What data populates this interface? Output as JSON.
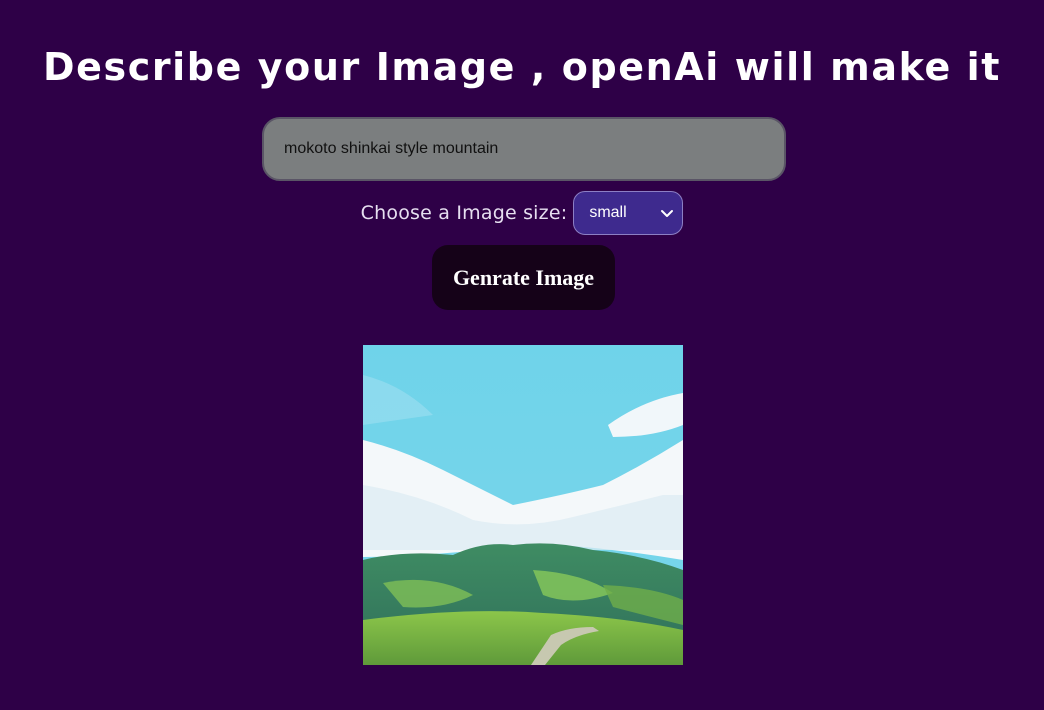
{
  "header": {
    "title": "Describe your Image , openAi will make it"
  },
  "prompt": {
    "value": "mokoto shinkai style mountain",
    "placeholder": ""
  },
  "size_picker": {
    "label": "Choose a Image size:",
    "selected": "small"
  },
  "generate_button": {
    "label": "Genrate Image"
  },
  "colors": {
    "background": "#2e0047",
    "input_bg": "#7b7e7f",
    "select_bg": "#3e2a8e",
    "button_bg": "#150218"
  },
  "result": {
    "alt": "generated landscape: blue sky with white clouds over a green mountain"
  }
}
